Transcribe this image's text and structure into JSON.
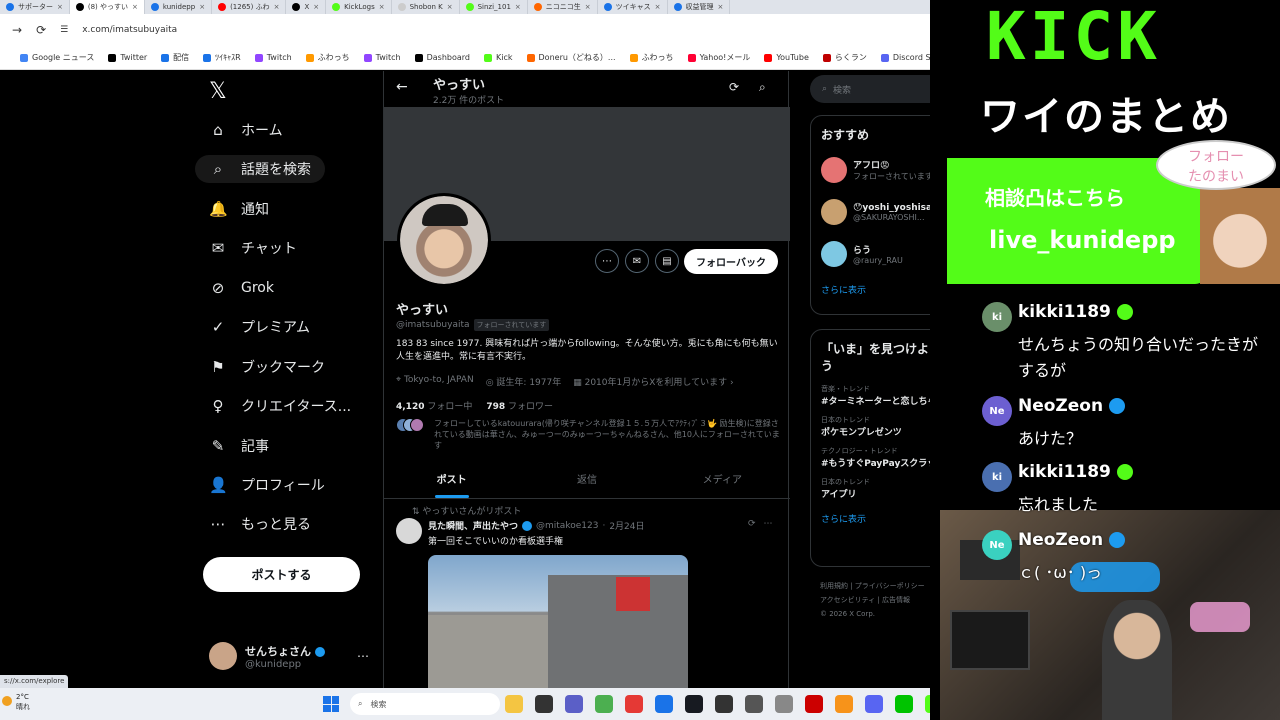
{
  "browser": {
    "tabs": [
      {
        "label": "サポーター",
        "color": "#1a73e8",
        "active": false
      },
      {
        "label": "(8) やっすい",
        "color": "#000000",
        "active": true
      },
      {
        "label": "kunidepp",
        "color": "#1a73e8",
        "active": false
      },
      {
        "label": "(1265) ふわ",
        "color": "#ff0000",
        "active": false
      },
      {
        "label": "X",
        "color": "#000000",
        "active": false
      },
      {
        "label": "KickLogs",
        "color": "#53fc18",
        "active": false
      },
      {
        "label": "Shobon K",
        "color": "#cccccc",
        "active": false
      },
      {
        "label": "Sinzi_101",
        "color": "#53fc18",
        "active": false
      },
      {
        "label": "ニコニコ生",
        "color": "#ff6600",
        "active": false
      },
      {
        "label": "ツイキャス",
        "color": "#1a73e8",
        "active": false
      },
      {
        "label": "収益管理",
        "color": "#1a73e8",
        "active": false
      }
    ],
    "url": "x.com/imatsubuyaita",
    "bookmarks": [
      {
        "label": "Google ニュース",
        "color": "#4285f4"
      },
      {
        "label": "Twitter",
        "color": "#000000"
      },
      {
        "label": "配信",
        "color": "#1a73e8"
      },
      {
        "label": "ﾂｲｷｬｽR",
        "color": "#1a73e8"
      },
      {
        "label": "Twitch",
        "color": "#9146ff"
      },
      {
        "label": "ふわっち",
        "color": "#ff9900"
      },
      {
        "label": "Twitch",
        "color": "#9146ff"
      },
      {
        "label": "Dashboard",
        "color": "#000000"
      },
      {
        "label": "Kick",
        "color": "#53fc18"
      },
      {
        "label": "Doneru（どねる）...",
        "color": "#ff6600"
      },
      {
        "label": "ふわっち",
        "color": "#ff9900"
      },
      {
        "label": "Yahoo!メール",
        "color": "#ff0033"
      },
      {
        "label": "YouTube",
        "color": "#ff0000"
      },
      {
        "label": "らくラン",
        "color": "#bf0000"
      },
      {
        "label": "Discord StreamKit O...",
        "color": "#5865f2"
      }
    ]
  },
  "nav": {
    "items": [
      {
        "label": "ホーム",
        "icon": "⌂",
        "name": "home"
      },
      {
        "label": "話題を検索",
        "icon": "⌕",
        "name": "explore"
      },
      {
        "label": "通知",
        "icon": "🔔",
        "name": "notifications"
      },
      {
        "label": "チャット",
        "icon": "✉",
        "name": "chat"
      },
      {
        "label": "Grok",
        "icon": "⊘",
        "name": "grok"
      },
      {
        "label": "プレミアム",
        "icon": "✓",
        "name": "premium"
      },
      {
        "label": "ブックマーク",
        "icon": "⚑",
        "name": "bookmarks"
      },
      {
        "label": "クリエイタース...",
        "icon": "♀",
        "name": "creator-studio"
      },
      {
        "label": "記事",
        "icon": "✎",
        "name": "articles"
      },
      {
        "label": "プロフィール",
        "icon": "👤",
        "name": "profile"
      },
      {
        "label": "もっと見る",
        "icon": "⋯",
        "name": "more"
      }
    ],
    "post_label": "ポストする",
    "account": {
      "name": "せんちょさん",
      "handle": "@kunidepp"
    }
  },
  "profile": {
    "title": "やっすい",
    "post_count": "2.2万 件のポスト",
    "name": "やっすい",
    "handle": "@imatsubuyaita",
    "follows_you": "フォローされています",
    "bio": "183 83 since 1977. 興味有れば片っ端からfollowing。そんな使い方。兎にも角にも何も無い人生を邁進中。常に有言不実行。",
    "location": "Tokyo-to, JAPAN",
    "birthday": "誕生年: 1977年",
    "joined": "2010年1月からXを利用しています",
    "following_count": "4,120",
    "following_label": "フォロー中",
    "followers_count": "798",
    "followers_label": "フォロワー",
    "followed_by": "フォローしているkatouurara(帰り咲チャンネル登録１５.５万人でｱｸﾃｨﾌﾞ３🤟 励生検)に登録されている動画は華さん、みゅーつーのみゅーつーちゃんねるさん、他10人にフォローされています",
    "followback_label": "フォローバック",
    "tabs": [
      "ポスト",
      "返信",
      "メディア"
    ]
  },
  "tweet": {
    "repost_note": "やっすいさんがリポスト",
    "author": "見た瞬間、声出たやつ",
    "handle": "@mitakoe123",
    "date": "2月24日",
    "text": "第一回そこでいいのか看板選手権"
  },
  "sidebar": {
    "search_placeholder": "検索",
    "recommend_title": "おすすめ",
    "recommendations": [
      {
        "name": "アフロ😡",
        "handle": "フォローされています",
        "color": "#e57373"
      },
      {
        "name": "😯yoshi_yoshisa",
        "handle": "@SAKURAYOSHI...",
        "color": "#c8a070"
      },
      {
        "name": "らう",
        "handle": "@raury_RAU",
        "color": "#7ec8e3"
      }
    ],
    "more_label": "さらに表示",
    "trends_title": "「いま」を見つけよう",
    "trends": [
      {
        "category": "音楽・トレンド",
        "topic": "#ターミネーターと恋しちゃったら"
      },
      {
        "category": "日本のトレンド",
        "topic": "ポケモンプレゼンツ"
      },
      {
        "category": "テクノロジー・トレンド",
        "topic": "#もうすぐPayPayスクラッチくじ開..."
      },
      {
        "category": "日本のトレンド",
        "topic": "アイプリ"
      }
    ],
    "trends_more": "さらに表示",
    "footer": [
      "利用規約 | プライバシーポリシー",
      "アクセシビリティ | 広告情報",
      "© 2026 X Corp."
    ]
  },
  "status_url": "s://x.com/explore",
  "taskbar": {
    "temperature": "2°C",
    "weather": "晴れ",
    "search_placeholder": "検索",
    "apps": [
      "#f4c542",
      "#333333",
      "#5b5fc7",
      "#4caf50",
      "#e53935",
      "#1a73e8",
      "#171a21",
      "#333333",
      "#555555",
      "#888888",
      "#cc0000",
      "#f7931a",
      "#5865f2",
      "#00c300",
      "#53fc18"
    ]
  },
  "overlay": {
    "kick": "KICK",
    "subtitle": "ワイのまとめ",
    "bubble": "フォロー\nたのまい",
    "box_line1": "相談凸はこちら",
    "box_line2": "live_kunidepp",
    "chat": [
      {
        "initials": "ki",
        "user": "kikki1189",
        "message": "せんちょうの知り合いだったきがするが",
        "avatar_color": "#6a8f6a",
        "badge_color": "#53fc18"
      },
      {
        "initials": "Ne",
        "user": "NeoZeon",
        "message": "あけた？",
        "avatar_color": "#6c5fd1",
        "badge_color": "#1d9bf0"
      },
      {
        "initials": "ki",
        "user": "kikki1189",
        "message": "忘れました",
        "avatar_color": "#4a6fb0",
        "badge_color": "#53fc18"
      },
      {
        "initials": "Ne",
        "user": "NeoZeon",
        "message": "ｃ( ･ω･ )っ",
        "avatar_color": "#3ad1c0",
        "badge_color": "#1d9bf0"
      }
    ]
  }
}
